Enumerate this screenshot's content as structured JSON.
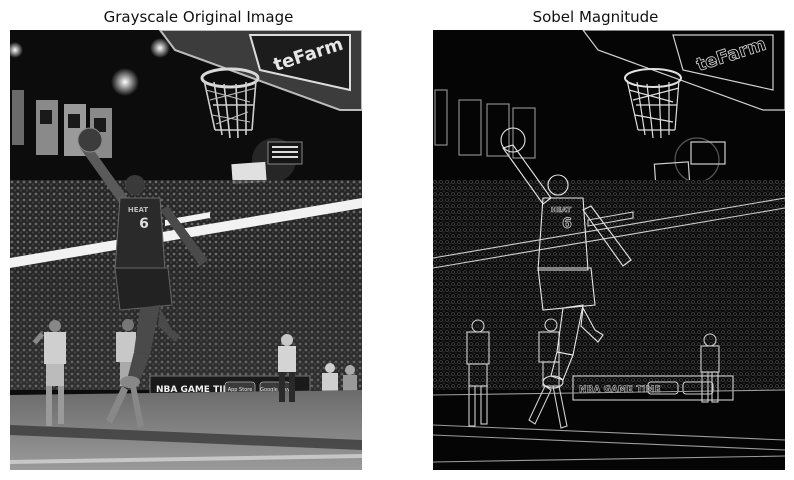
{
  "figure": {
    "left_title": "Grayscale Original Image",
    "right_title": "Sobel Magnitude"
  },
  "banner": {
    "ad_text": "NBA GAME TIME",
    "store_text": "App Store",
    "play_text": "Google Play",
    "jersey_text": "HEAT",
    "jersey_number": "6",
    "statefarm_text": "teFarm"
  },
  "colors": {
    "left_bg": "#0c0c0c",
    "right_bg": "#050505",
    "edge": "#d8d8d8"
  }
}
